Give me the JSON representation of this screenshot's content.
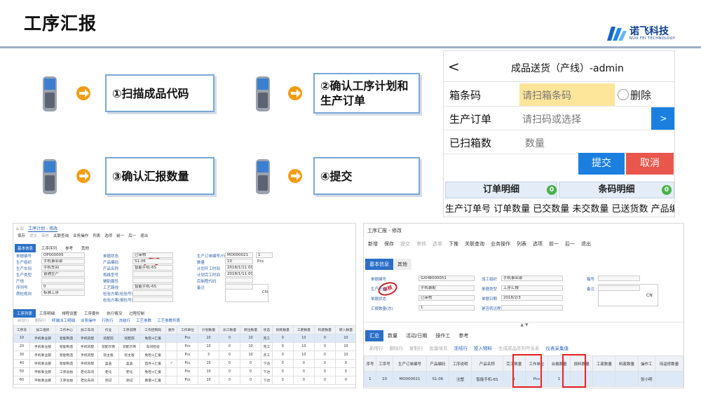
{
  "slide": {
    "title": "工序汇报"
  },
  "logo": {
    "cn": "诺飞科技",
    "en": "NUO FEI TECHNOLOGY"
  },
  "steps": [
    {
      "label": "①扫描成品代码"
    },
    {
      "label": "②确认工序计划和生产订单"
    },
    {
      "label": "③确认汇报数量"
    },
    {
      "label": "④提交"
    }
  ],
  "mobile": {
    "back": "<",
    "title": "成品送货（产线）-admin",
    "rows": [
      {
        "label": "箱条码",
        "placeholder": "请扫箱条码",
        "extra": "删除"
      },
      {
        "label": "生产订单",
        "placeholder": "请扫码或选择",
        "action": ">"
      },
      {
        "label": "已扫箱数",
        "value": "数量"
      }
    ],
    "submit": "提交",
    "cancel": "取消",
    "tabs": [
      {
        "label": "订单明细",
        "count": "0"
      },
      {
        "label": "条码明细",
        "count": "0"
      }
    ],
    "columns": "生产订单号 订单数量 已交数量 未交数量 已送货数 产品编"
  },
  "left_screen": {
    "breadcrumb": "工序计划 - 修改",
    "toolbar": [
      "保存",
      "提交",
      "审核",
      "关联查询",
      "业务操作",
      "列表",
      "选项",
      "前一",
      "后一",
      "退出"
    ],
    "tabs": [
      "基本信息",
      "工序序列",
      "参考",
      "其他"
    ],
    "fields": [
      {
        "label": "单据编号",
        "value": "OP000005"
      },
      {
        "label": "生产组织",
        "value": "手机事业部"
      },
      {
        "label": "生产车间",
        "value": "手机车间"
      },
      {
        "label": "生产类型",
        "value": "普通生产"
      },
      {
        "label": "产线",
        "value": ""
      },
      {
        "label": "序列号",
        "value": "0"
      },
      {
        "label": "质检规则",
        "value": "标准工序"
      }
    ],
    "fields2": [
      {
        "label": "单据状态",
        "value": "已审核"
      },
      {
        "label": "产品编码",
        "value": "S1.06"
      },
      {
        "label": "产品名称",
        "value": "智能手机-6S"
      },
      {
        "label": "规格型号",
        "value": ""
      },
      {
        "label": "辅助属性",
        "value": ""
      },
      {
        "label": "工艺路线",
        "value": "智能手机-6S"
      },
      {
        "label": "检验方案(检验号)",
        "value": ""
      },
      {
        "label": "检验方案(报检号)",
        "value": ""
      }
    ],
    "fields3": [
      {
        "label": "生产订单编号/行号",
        "value": "MO000021",
        "value2": "1"
      },
      {
        "label": "数量",
        "value": "10",
        "unit": "Pcs"
      },
      {
        "label": "计划开工时间",
        "value": "2018/1/11 00:00:00"
      },
      {
        "label": "计划完工时间",
        "value": "2018/1/11 00:00:00"
      },
      {
        "label": "后制程代码",
        "value": ""
      },
      {
        "label": "备注",
        "value": ""
      }
    ],
    "stamp": "审核",
    "lang": "CN",
    "sub_tabs": [
      "工序列表",
      "工序明细",
      "排程设置",
      "工序委外",
      "执行情况",
      "过程控制"
    ],
    "sub_toolbar": [
      "新增行",
      "删除行",
      "终端派工明细",
      "业务操作",
      "行执行",
      "冻结行",
      "工艺参数",
      "工艺参数列表"
    ],
    "columns": [
      "工序号",
      "加工组织",
      "工作中心",
      "加工车间",
      "作业",
      "工序说明",
      "工作控制码",
      "委外",
      "工作单位",
      "计划数量",
      "派工数量",
      "转出数量",
      "状态",
      "损耗数量",
      "工废数量",
      "料废数量",
      "转入数量"
    ],
    "rows": [
      [
        "10",
        "手机事业部",
        "智能制造",
        "手机装配",
        "装配前",
        "装配前",
        "免检+汇报",
        "",
        "Pcs",
        "10",
        "0",
        "10",
        "完工",
        "0",
        "10",
        "0",
        "10"
      ],
      [
        "20",
        "手机事业部",
        "智能制造",
        "手机装配",
        "装配示例",
        "装配示例",
        "车间检验",
        "",
        "Pcs",
        "10",
        "0",
        "10",
        "完工",
        "0",
        "10",
        "0",
        "10"
      ],
      [
        "30",
        "手机事业部",
        "智能制造",
        "手机装配",
        "装主板",
        "装主板",
        "免检+汇报",
        "",
        "Pcs",
        "3",
        "0",
        "10",
        "开工",
        "0",
        "10",
        "0",
        "10"
      ],
      [
        "40",
        "手机事业部",
        "智能制造",
        "手机装配",
        "盒盖",
        "盒盖",
        "首件+汇报",
        "✓",
        "Pcs",
        "10",
        "0",
        "0",
        "下达",
        "0",
        "0",
        "0",
        "0"
      ],
      [
        "50",
        "平板事业部",
        "工序总拍",
        "老化车间",
        "老化",
        "老化",
        "免检+汇报",
        "",
        "Pcs",
        "10",
        "0",
        "0",
        "下达",
        "0",
        "0",
        "0",
        "0"
      ],
      [
        "60",
        "平板事业部",
        "工序总拍",
        "老化车间",
        "测试",
        "测试",
        "质量+汇报",
        "",
        "Pcs",
        "10",
        "0",
        "0",
        "下达",
        "0",
        "0",
        "0",
        "0"
      ]
    ]
  },
  "right_screen": {
    "breadcrumb": "工序汇报 - 修改",
    "toolbar": [
      "新增",
      "保存",
      "提交",
      "审核",
      "选单",
      "下推",
      "关联查询",
      "业务操作",
      "列表",
      "选项",
      "前一",
      "后一",
      "退出"
    ],
    "tabs": [
      "基本信息",
      "其他"
    ],
    "fields": [
      {
        "label": "单据编号",
        "value": "GXHB000051"
      },
      {
        "label": "生产车间",
        "value": "手机装配"
      },
      {
        "label": "单据状态",
        "value": "已审核"
      },
      {
        "label": "汇报数量(总)",
        "value": "1"
      }
    ],
    "fields2": [
      {
        "label": "加工组织",
        "value": "手机事业部"
      },
      {
        "label": "单据类型",
        "value": "工序汇报"
      },
      {
        "label": "单据日期",
        "value": "2018/2/3"
      },
      {
        "label": "是否转远程审核",
        "value": ""
      }
    ],
    "fields3": [
      {
        "label": "箱号",
        "value": ""
      },
      {
        "label": "备注",
        "value": ""
      }
    ],
    "stamp": "审核",
    "lang": "CN",
    "sub_tabs": [
      "汇总",
      "数量",
      "活动/日期",
      "操作工",
      "参考"
    ],
    "sub_toolbar": [
      "新增行",
      "删除行",
      "复制行",
      "批量填充",
      "冻结行",
      "投入物料",
      "生成成品序列号关系",
      "仪表采集值"
    ],
    "columns": [
      "序号",
      "工序号",
      "生产订单编号",
      "产品编码",
      "工序说明",
      "产品名称",
      "完工数量",
      "工作单位",
      "合格数量",
      "损料数量",
      "工废数量",
      "料废数量",
      "操作工",
      "待返修数量"
    ],
    "rows": [
      [
        "1",
        "10",
        "MO000021",
        "S1.06",
        "注塑",
        "智能手机-6S",
        "1",
        "Pcs",
        "1",
        "",
        "",
        "",
        "张小明",
        ""
      ]
    ]
  }
}
